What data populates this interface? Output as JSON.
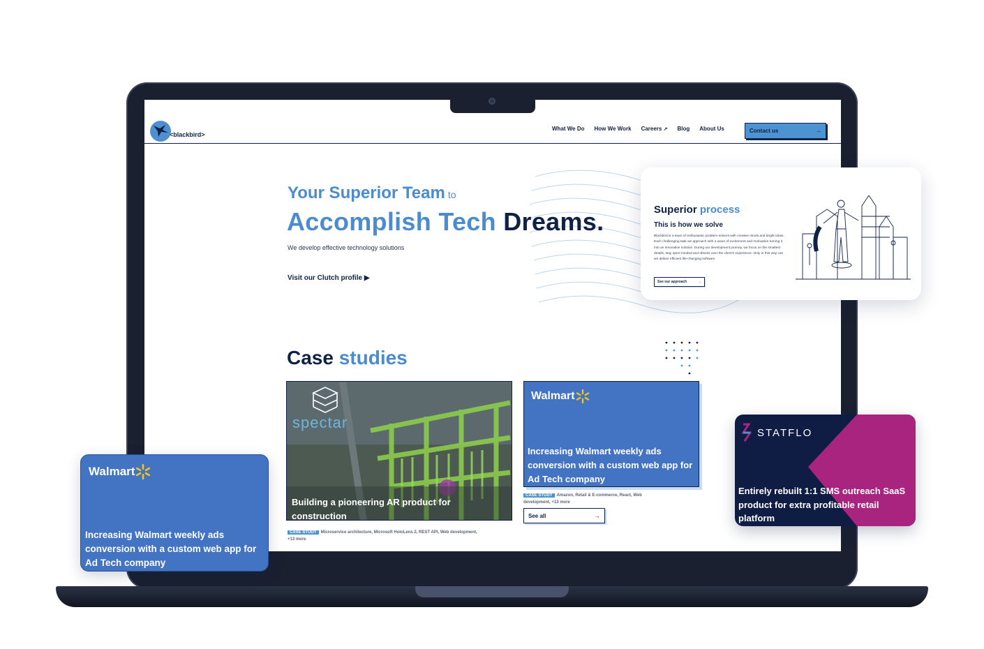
{
  "header": {
    "logo_text": "<blackbird>",
    "nav": [
      "What We Do",
      "How We Work",
      "Careers",
      "Blog",
      "About Us"
    ],
    "contact_label": "Contact us"
  },
  "hero": {
    "line1": "Your Superior Team",
    "line1_suffix": "to",
    "line2_light": "Accomplish Tech",
    "line2_dark": "Dreams.",
    "subtitle": "We develop effective technology solutions",
    "clutch_link": "Visit our Clutch profile"
  },
  "case_studies": {
    "title_dark": "Case",
    "title_light": "studies",
    "cards": [
      {
        "logo": "spectar",
        "title": "Building a pioneering AR product for construction",
        "badge": "CASE STUDY",
        "tags": "Microservice architecture, Microsoft HoloLens 2, REST API, Web development,",
        "more": "+13 more"
      },
      {
        "logo": "Walmart",
        "title": "Increasing Walmart weekly ads conversion with a custom web app for Ad Tech company",
        "badge": "CASE STUDY",
        "tags": "Amazon, Retail & E-commerce, React, Web",
        "tags_line2": "development,",
        "more": "+13 more"
      }
    ],
    "see_all": "See all"
  },
  "process_card": {
    "title_dark": "Superior",
    "title_light": "process",
    "subtitle": "This is how we solve",
    "body": "Blackbird is a team of enthusiastic problem-solvers with creative minds and bright ideas. Each challenging task we approach with a wave of excitement and motivation turning it into an innovative solution. During our development journey, we focus on the smallest details, stay open-minded and obsess over the client's experience. Only in this way can we deliver efficient life-changing software",
    "button": "See our approach"
  },
  "float_walmart": {
    "logo": "Walmart",
    "title": "Increasing Walmart weekly ads conversion with a custom web app for Ad Tech company"
  },
  "float_statflo": {
    "logo": "STATFLO",
    "title": "Entirely rebuilt 1:1 SMS outreach SaaS product for extra profitable retail platform"
  },
  "colors": {
    "brand_blue": "#4a8ccf",
    "navy": "#0f2245",
    "walmart_blue": "#4374c4",
    "walmart_spark": "#f5c518",
    "statflo_magenta": "#a8247f"
  }
}
